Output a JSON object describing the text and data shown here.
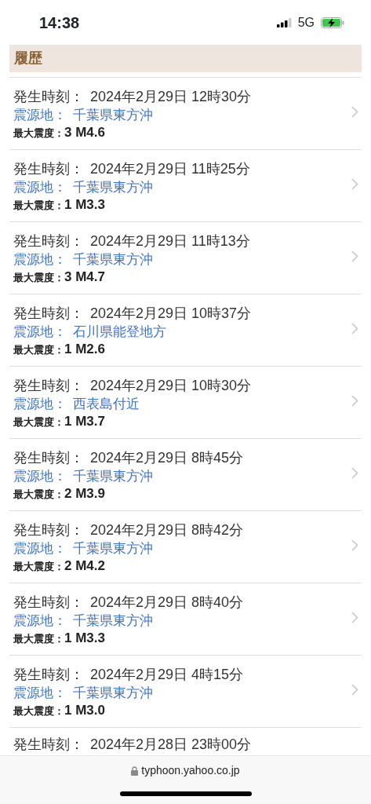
{
  "status_bar": {
    "time": "14:38",
    "network": "5G"
  },
  "section": {
    "title": "履歴"
  },
  "quakes": [
    {
      "time_label": "発生時刻：",
      "time": "2024年2月29日 12時30分",
      "origin_label": "震源地：",
      "origin": "千葉県東方沖",
      "intensity_label": "最大震度：",
      "intensity": "3 M4.6"
    },
    {
      "time_label": "発生時刻：",
      "time": "2024年2月29日 11時25分",
      "origin_label": "震源地：",
      "origin": "千葉県東方沖",
      "intensity_label": "最大震度：",
      "intensity": "1 M3.3"
    },
    {
      "time_label": "発生時刻：",
      "time": "2024年2月29日 11時13分",
      "origin_label": "震源地：",
      "origin": "千葉県東方沖",
      "intensity_label": "最大震度：",
      "intensity": "3 M4.7"
    },
    {
      "time_label": "発生時刻：",
      "time": "2024年2月29日 10時37分",
      "origin_label": "震源地：",
      "origin": "石川県能登地方",
      "intensity_label": "最大震度：",
      "intensity": "1 M2.6"
    },
    {
      "time_label": "発生時刻：",
      "time": "2024年2月29日 10時30分",
      "origin_label": "震源地：",
      "origin": "西表島付近",
      "intensity_label": "最大震度：",
      "intensity": "1 M3.7"
    },
    {
      "time_label": "発生時刻：",
      "time": "2024年2月29日 8時45分",
      "origin_label": "震源地：",
      "origin": "千葉県東方沖",
      "intensity_label": "最大震度：",
      "intensity": "2 M3.9"
    },
    {
      "time_label": "発生時刻：",
      "time": "2024年2月29日 8時42分",
      "origin_label": "震源地：",
      "origin": "千葉県東方沖",
      "intensity_label": "最大震度：",
      "intensity": "2 M4.2"
    },
    {
      "time_label": "発生時刻：",
      "time": "2024年2月29日 8時40分",
      "origin_label": "震源地：",
      "origin": "千葉県東方沖",
      "intensity_label": "最大震度：",
      "intensity": "1 M3.3"
    },
    {
      "time_label": "発生時刻：",
      "time": "2024年2月29日 4時15分",
      "origin_label": "震源地：",
      "origin": "千葉県東方沖",
      "intensity_label": "最大震度：",
      "intensity": "1 M3.0"
    },
    {
      "time_label": "発生時刻：",
      "time": "2024年2月28日 23時00分"
    }
  ],
  "browser_bar": {
    "url": "typhoon.yahoo.co.jp"
  }
}
